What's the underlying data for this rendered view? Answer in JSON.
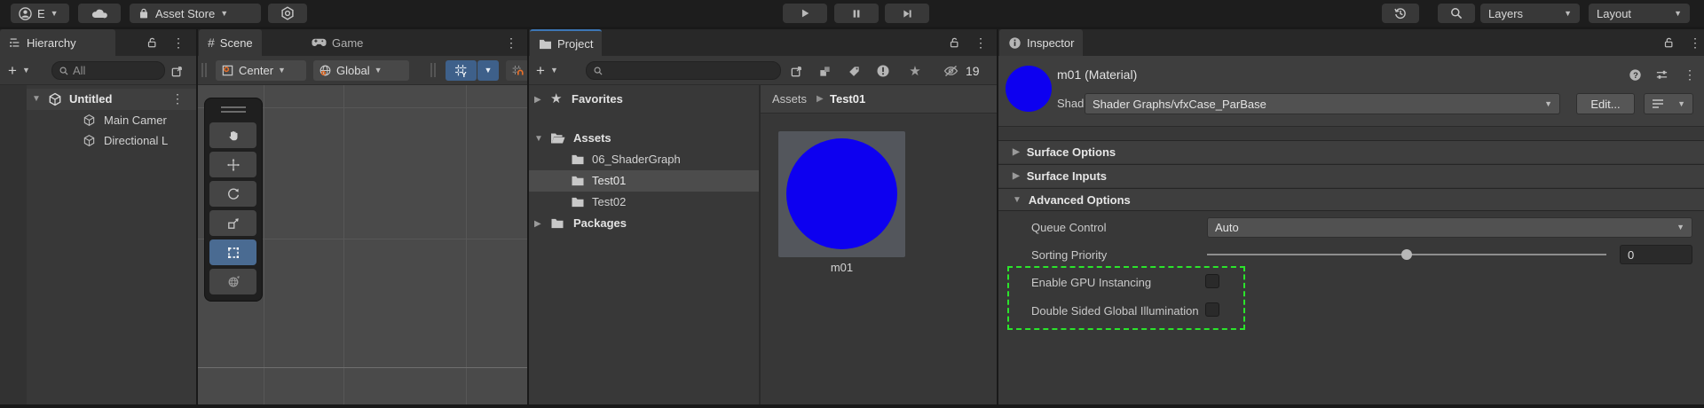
{
  "toolbar": {
    "account": "E",
    "asset_store": "Asset Store",
    "layers": "Layers",
    "layout": "Layout"
  },
  "hierarchy": {
    "tab": "Hierarchy",
    "search": "All",
    "root": "Untitled",
    "children": [
      "Main Camer",
      "Directional L"
    ]
  },
  "scene_view": {
    "scene_tab": "Scene",
    "game_tab": "Game",
    "pivot": "Center",
    "orientation": "Global"
  },
  "project": {
    "tab": "Project",
    "favorites": "Favorites",
    "assets_root": "Assets",
    "folders": [
      "06_ShaderGraph",
      "Test01",
      "Test02"
    ],
    "selected_folder": "Test01",
    "packages": "Packages",
    "breadcrumb_root": "Assets",
    "breadcrumb_current": "Test01",
    "asset_name": "m01",
    "hidden_count": "19"
  },
  "inspector": {
    "tab": "Inspector",
    "title": "m01 (Material)",
    "shader_label": "Shader",
    "shader_value": "Shader Graphs/vfxCase_ParBase",
    "edit_button": "Edit...",
    "sections": {
      "surface_options": "Surface Options",
      "surface_inputs": "Surface Inputs",
      "advanced_options": "Advanced Options"
    },
    "queue_control_label": "Queue Control",
    "queue_control_value": "Auto",
    "sorting_priority_label": "Sorting Priority",
    "sorting_priority_value": "0",
    "gpu_instancing_label": "Enable GPU Instancing",
    "gpu_instancing_checked": false,
    "double_sided_gi_label": "Double Sided Global Illumination",
    "double_sided_gi_checked": false,
    "highlight_color": "#2be52b",
    "material_preview_color": "#0d00f0"
  }
}
